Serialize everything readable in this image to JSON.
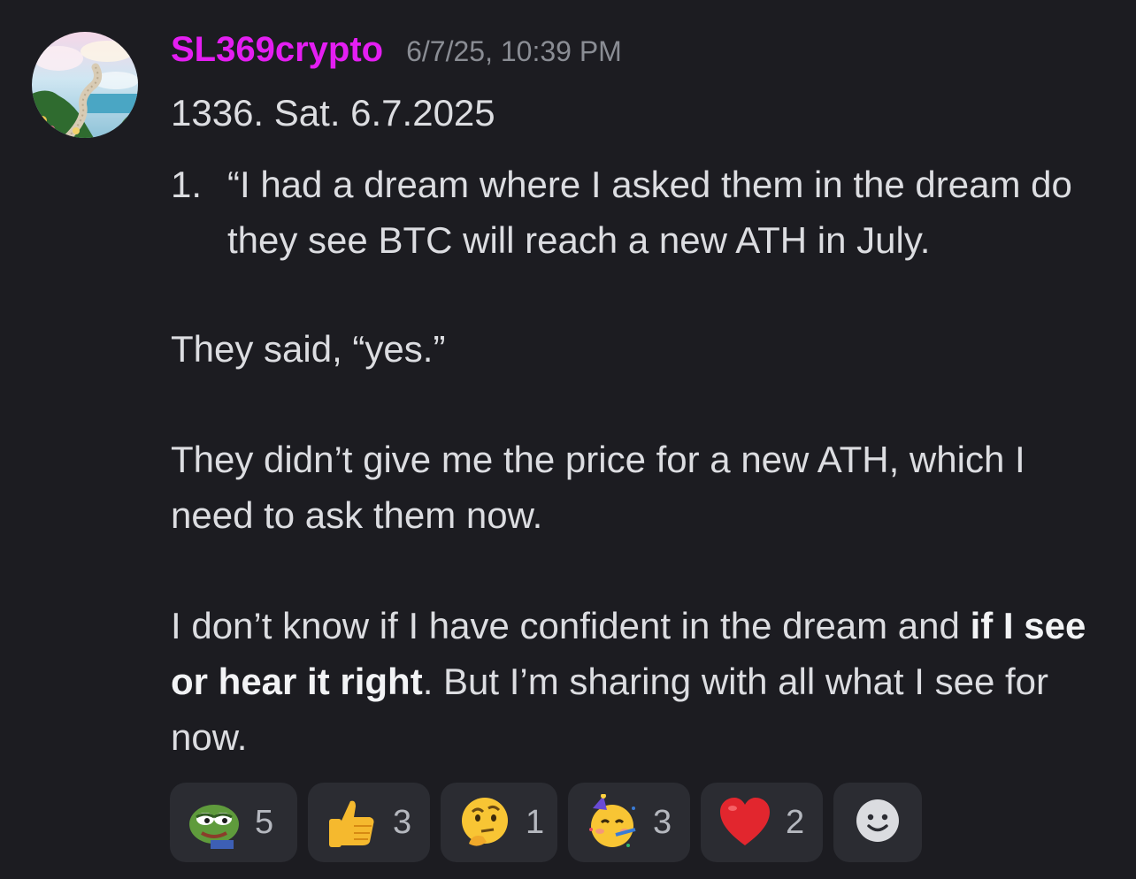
{
  "message": {
    "avatar": "stairway-to-heaven-avatar",
    "username": "SL369crypto",
    "username_color": "#e41ef2",
    "timestamp": "6/7/25, 10:39 PM",
    "title_line": "1336.  Sat. 6.7.2025",
    "list_item": {
      "number": "1.",
      "text": "“I had a dream where I asked them in the dream do they see BTC will reach a new ATH in July."
    },
    "para1": "They said, “yes.”",
    "para2": "They didn’t give me the price for a new ATH, which I need to ask them now.",
    "para3": {
      "before": "I don’t know if I have confident in the dream and ",
      "bold": "if I see or hear it right",
      "after": ". But I’m sharing with all what I see for now."
    }
  },
  "reactions": [
    {
      "icon": "pepe-frog-emoji",
      "count": "5"
    },
    {
      "icon": "thumbs-up-emoji",
      "count": "3"
    },
    {
      "icon": "thinking-face-emoji",
      "count": "1"
    },
    {
      "icon": "partying-face-emoji",
      "count": "3"
    },
    {
      "icon": "red-heart-emoji",
      "count": "2"
    }
  ],
  "add_reaction_icon": "add-reaction-smiley-icon"
}
